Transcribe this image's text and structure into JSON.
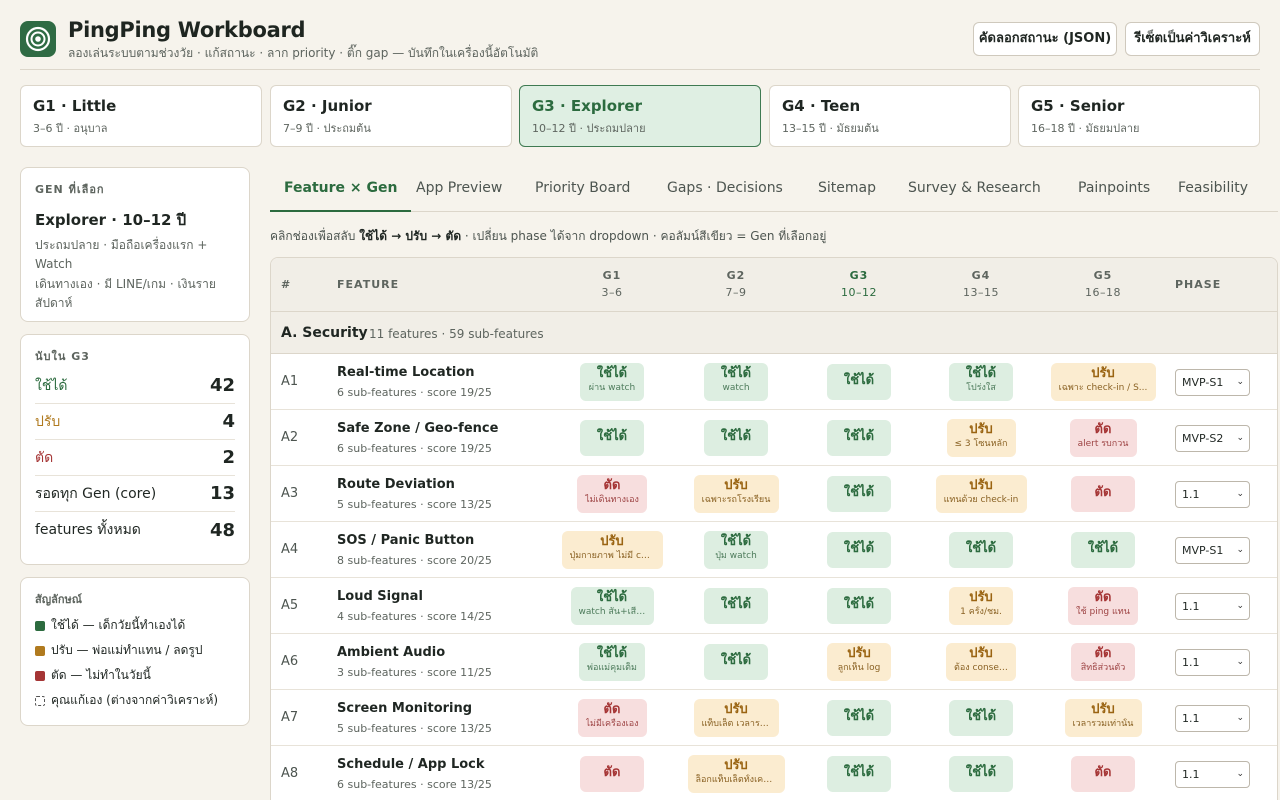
{
  "header": {
    "title": "PingPing Workboard",
    "subtitle": "ลองเล่นระบบตามช่วงวัย · แก้สถานะ · ลาก priority · ติ๊ก gap — บันทึกในเครื่องนี้อัตโนมัติ",
    "copy_button": "คัดลอกสถานะ (JSON)",
    "reset_button": "รีเซ็ตเป็นค่าวิเคราะห์"
  },
  "gens": [
    {
      "name": "G1 · Little",
      "desc": "3–6 ปี · อนุบาล"
    },
    {
      "name": "G2 · Junior",
      "desc": "7–9 ปี · ประถมต้น"
    },
    {
      "name": "G3 · Explorer",
      "desc": "10–12 ปี · ประถมปลาย"
    },
    {
      "name": "G4 · Teen",
      "desc": "13–15 ปี · มัธยมต้น"
    },
    {
      "name": "G5 · Senior",
      "desc": "16–18 ปี · มัธยมปลาย"
    }
  ],
  "selected": {
    "label": "GEN ที่เลือก",
    "name": "Explorer · 10–12 ปี",
    "desc1": "ประถมปลาย · มือถือเครื่องแรก + Watch",
    "desc2": "เดินทางเอง · มี LINE/เกม · เงินรายสัปดาห์"
  },
  "counts": {
    "label": "นับใน G3",
    "items": [
      {
        "label": "ใช้ได้",
        "value": "42"
      },
      {
        "label": "ปรับ",
        "value": "4"
      },
      {
        "label": "ตัด",
        "value": "2"
      },
      {
        "label": "รอดทุก Gen (core)",
        "value": "13"
      },
      {
        "label": "features ทั้งหมด",
        "value": "48"
      }
    ]
  },
  "legend": {
    "label": "สัญลักษณ์",
    "items": [
      {
        "text": "ใช้ได้ — เด็กวัยนี้ทำเองได้"
      },
      {
        "text": "ปรับ — พ่อแม่ทำแทน / ลดรูป"
      },
      {
        "text": "ตัด — ไม่ทำในวัยนี้"
      },
      {
        "text": "คุณแก้เอง (ต่างจากค่าวิเคราะห์)"
      }
    ]
  },
  "colors": {
    "use": "#2c6b3f",
    "adjust": "#b07a1f",
    "cut": "#a53535",
    "accent": "#2f6b44"
  },
  "tabs": [
    "Feature × Gen",
    "App Preview",
    "Priority Board",
    "Gaps · Decisions",
    "Sitemap",
    "Survey & Research",
    "Painpoints",
    "Feasibility"
  ],
  "hint": {
    "pre": "คลิกช่องเพื่อสลับ ",
    "bold": "ใช้ได้ → ปรับ → ตัด",
    "post": " · เปลี่ยน phase ได้จาก dropdown · คอลัมน์สีเขียว = Gen ที่เลือกอยู่"
  },
  "table": {
    "col_num": "#",
    "col_feature": "FEATURE",
    "col_phase": "PHASE",
    "gen_cols": [
      {
        "code": "G1",
        "range": "3–6"
      },
      {
        "code": "G2",
        "range": "7–9"
      },
      {
        "code": "G3",
        "range": "10–12"
      },
      {
        "code": "G4",
        "range": "13–15"
      },
      {
        "code": "G5",
        "range": "16–18"
      }
    ],
    "group": {
      "title": "A. Security",
      "meta": "11 features · 59 sub-features"
    },
    "status_labels": {
      "use": "ใช้ได้",
      "adj": "ปรับ",
      "cut": "ตัด"
    },
    "rows": [
      {
        "id": "A1",
        "name": "Real-time Location",
        "meta": "6 sub-features · score 19/25",
        "phase": "MVP-S1",
        "cells": [
          {
            "s": "use",
            "n": "ผ่าน watch"
          },
          {
            "s": "use",
            "n": "watch"
          },
          {
            "s": "use",
            "n": ""
          },
          {
            "s": "use",
            "n": "โปร่งใส"
          },
          {
            "s": "adj",
            "n": "เฉพาะ check-in / S..."
          }
        ]
      },
      {
        "id": "A2",
        "name": "Safe Zone / Geo-fence",
        "meta": "6 sub-features · score 19/25",
        "phase": "MVP-S2",
        "cells": [
          {
            "s": "use",
            "n": ""
          },
          {
            "s": "use",
            "n": ""
          },
          {
            "s": "use",
            "n": ""
          },
          {
            "s": "adj",
            "n": "≤ 3 โซนหลัก"
          },
          {
            "s": "cut",
            "n": "alert รบกวน"
          }
        ]
      },
      {
        "id": "A3",
        "name": "Route Deviation",
        "meta": "5 sub-features · score 13/25",
        "phase": "1.1",
        "cells": [
          {
            "s": "cut",
            "n": "ไม่เดินทางเอง"
          },
          {
            "s": "adj",
            "n": "เฉพาะรถโรงเรียน"
          },
          {
            "s": "use",
            "n": ""
          },
          {
            "s": "adj",
            "n": "แทนด้วย check-in"
          },
          {
            "s": "cut",
            "n": ""
          }
        ]
      },
      {
        "id": "A4",
        "name": "SOS / Panic Button",
        "meta": "8 sub-features · score 20/25",
        "phase": "MVP-S1",
        "cells": [
          {
            "s": "adj",
            "n": "ปุ่มกายภาพ ไม่มี co..."
          },
          {
            "s": "use",
            "n": "ปุ่ม watch"
          },
          {
            "s": "use",
            "n": ""
          },
          {
            "s": "use",
            "n": ""
          },
          {
            "s": "use",
            "n": ""
          }
        ]
      },
      {
        "id": "A5",
        "name": "Loud Signal",
        "meta": "4 sub-features · score 14/25",
        "phase": "1.1",
        "cells": [
          {
            "s": "use",
            "n": "watch สั่น+เสียง"
          },
          {
            "s": "use",
            "n": ""
          },
          {
            "s": "use",
            "n": ""
          },
          {
            "s": "adj",
            "n": "1 ครั้ง/ชม."
          },
          {
            "s": "cut",
            "n": "ใช้ ping แทน"
          }
        ]
      },
      {
        "id": "A6",
        "name": "Ambient Audio",
        "meta": "3 sub-features · score 11/25",
        "phase": "1.1",
        "cells": [
          {
            "s": "use",
            "n": "พ่อแม่คุมเต็ม"
          },
          {
            "s": "use",
            "n": ""
          },
          {
            "s": "adj",
            "n": "ลูกเห็น log"
          },
          {
            "s": "adj",
            "n": "ต้อง consent"
          },
          {
            "s": "cut",
            "n": "สิทธิส่วนตัว"
          }
        ]
      },
      {
        "id": "A7",
        "name": "Screen Monitoring",
        "meta": "5 sub-features · score 13/25",
        "phase": "1.1",
        "cells": [
          {
            "s": "cut",
            "n": "ไม่มีเครื่องเอง"
          },
          {
            "s": "adj",
            "n": "แท็บเล็ต เวลารวม"
          },
          {
            "s": "use",
            "n": ""
          },
          {
            "s": "use",
            "n": ""
          },
          {
            "s": "adj",
            "n": "เวลารวมเท่านั้น"
          }
        ]
      },
      {
        "id": "A8",
        "name": "Schedule / App Lock",
        "meta": "6 sub-features · score 13/25",
        "phase": "1.1",
        "cells": [
          {
            "s": "cut",
            "n": ""
          },
          {
            "s": "adj",
            "n": "ล็อกแท็บเล็ตทั้งเครื..."
          },
          {
            "s": "use",
            "n": ""
          },
          {
            "s": "use",
            "n": ""
          },
          {
            "s": "cut",
            "n": ""
          }
        ]
      }
    ]
  }
}
